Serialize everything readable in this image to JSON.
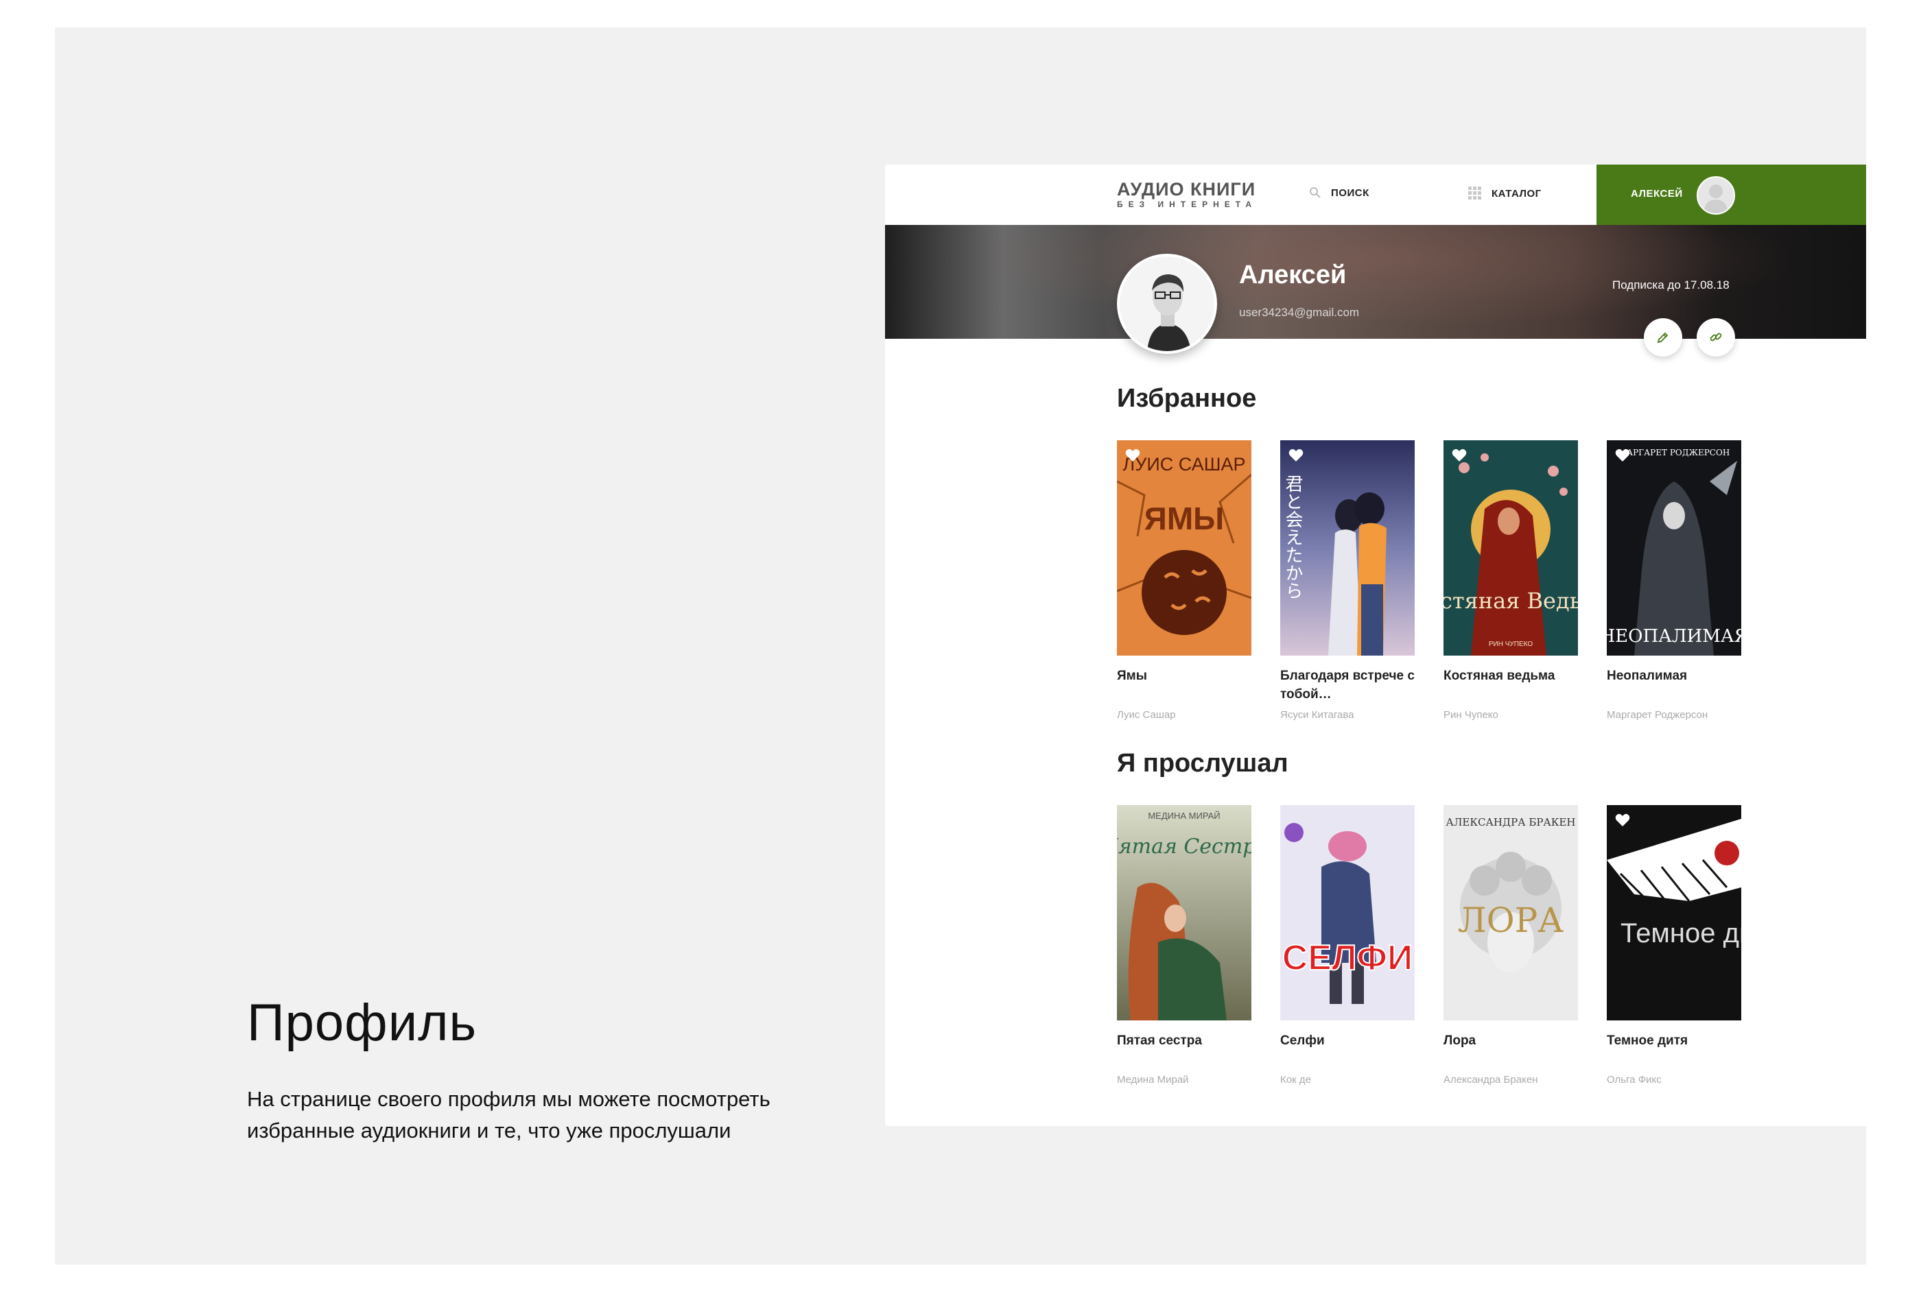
{
  "intro": {
    "title": "Профиль",
    "text": "На странице своего профиля мы можете посмотреть избранные аудиокниги и те, что уже прослушали"
  },
  "header": {
    "logo_main": "АУДИО КНИГИ",
    "logo_sub": "БЕЗ ИНТЕРНЕТА",
    "search_label": "ПОИСК",
    "catalog_label": "КАТАЛОГ",
    "user_label": "АЛЕКСЕЙ",
    "accent_color": "#4a7a18"
  },
  "profile": {
    "name": "Алексей",
    "email": "user34234@gmail.com",
    "subscription": "Подписка до 17.08.18"
  },
  "favorites": {
    "title": "Избранное",
    "books": [
      {
        "title": "Ямы",
        "author": "Луис Сашар",
        "cover_author": "ЛУИС САШАР",
        "cover_title": "ЯМЫ"
      },
      {
        "title": "Благодаря встрече с тобой…",
        "author": "Ясуси Китагава",
        "cover_author": "",
        "cover_title": "君と会えたから"
      },
      {
        "title": "Костяная ведьма",
        "author": "Рин Чупеко",
        "cover_author": "РИН ЧУПЕКО",
        "cover_title": "Костяная Ведьма"
      },
      {
        "title": "Неопалимая",
        "author": "Маргарет Роджерсон",
        "cover_author": "МАРГАРЕТ РОДЖЕРСОН",
        "cover_title": "НЕОПАЛИМАЯ"
      }
    ]
  },
  "listened": {
    "title": "Я прослушал",
    "books": [
      {
        "title": "Пятая сестра",
        "author": "Медина Мирай",
        "cover_author": "МЕДИНА МИРАЙ",
        "cover_title": "Пятая Сестра"
      },
      {
        "title": "Селфи",
        "author": "Кок де",
        "cover_author": "",
        "cover_title": "СЕЛФИ"
      },
      {
        "title": "Лора",
        "author": "Александра Бракен",
        "cover_author": "АЛЕКСАНДРА БРАКЕН",
        "cover_title": "ЛОРА"
      },
      {
        "title": "Темное дитя",
        "author": "Ольга Фикс",
        "cover_author": "",
        "cover_title": "Темное дитя"
      }
    ]
  }
}
